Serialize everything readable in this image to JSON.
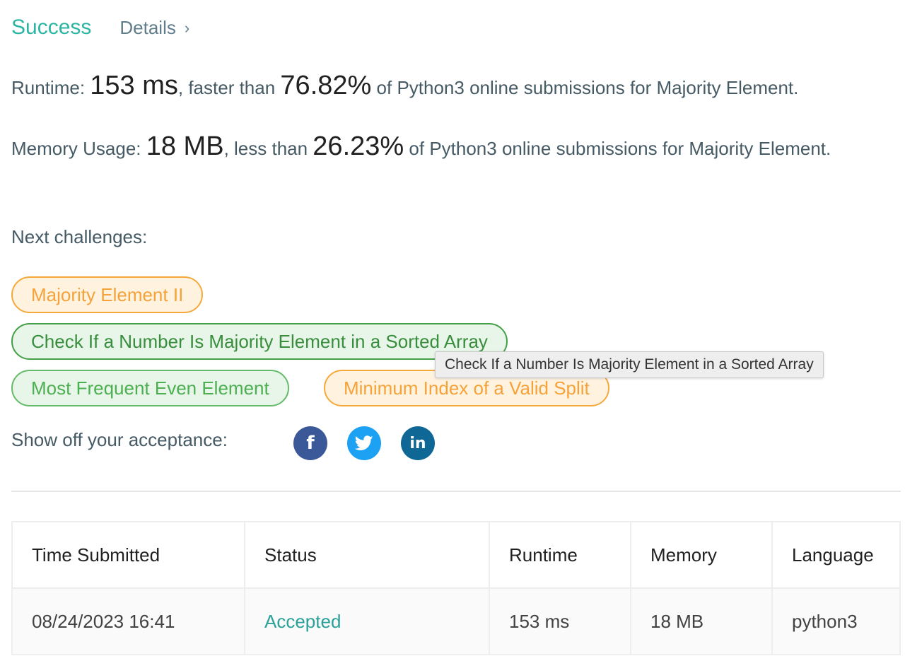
{
  "header": {
    "status": "Success",
    "details_label": "Details",
    "details_chevron": "›"
  },
  "runtime": {
    "label": "Runtime: ",
    "value": "153 ms",
    "comparison": ", faster than ",
    "percent": "76.82%",
    "suffix": " of Python3 online submissions for Majority Element."
  },
  "memory": {
    "label": "Memory Usage: ",
    "value": "18 MB",
    "comparison": ", less than ",
    "percent": "26.23%",
    "suffix": " of Python3 online submissions for Majority Element."
  },
  "next_challenges": {
    "label": "Next challenges:",
    "items": [
      {
        "title": "Majority Element II",
        "difficulty": "medium"
      },
      {
        "title": "Check If a Number Is Majority Element in a Sorted Array",
        "difficulty": "easy"
      },
      {
        "title": "Most Frequent Even Element",
        "difficulty": "easy"
      },
      {
        "title": "Minimum Index of a Valid Split",
        "difficulty": "medium"
      }
    ],
    "tooltip": "Check If a Number Is Majority Element in a Sorted Array"
  },
  "share": {
    "label": "Show off your acceptance:",
    "icons": [
      "facebook-icon",
      "twitter-icon",
      "linkedin-icon"
    ],
    "facebook_glyph": "f",
    "linkedin_glyph": "in"
  },
  "colors": {
    "success": "#2db5a3",
    "medium": "#f5a23a",
    "easy": "#4caf50",
    "facebook": "#3b5998",
    "twitter": "#1da1f2",
    "linkedin": "#0e6795"
  },
  "submissions": {
    "columns": [
      "Time Submitted",
      "Status",
      "Runtime",
      "Memory",
      "Language"
    ],
    "rows": [
      [
        "08/24/2023 16:41",
        "Accepted",
        "153 ms",
        "18 MB",
        "python3"
      ]
    ]
  }
}
